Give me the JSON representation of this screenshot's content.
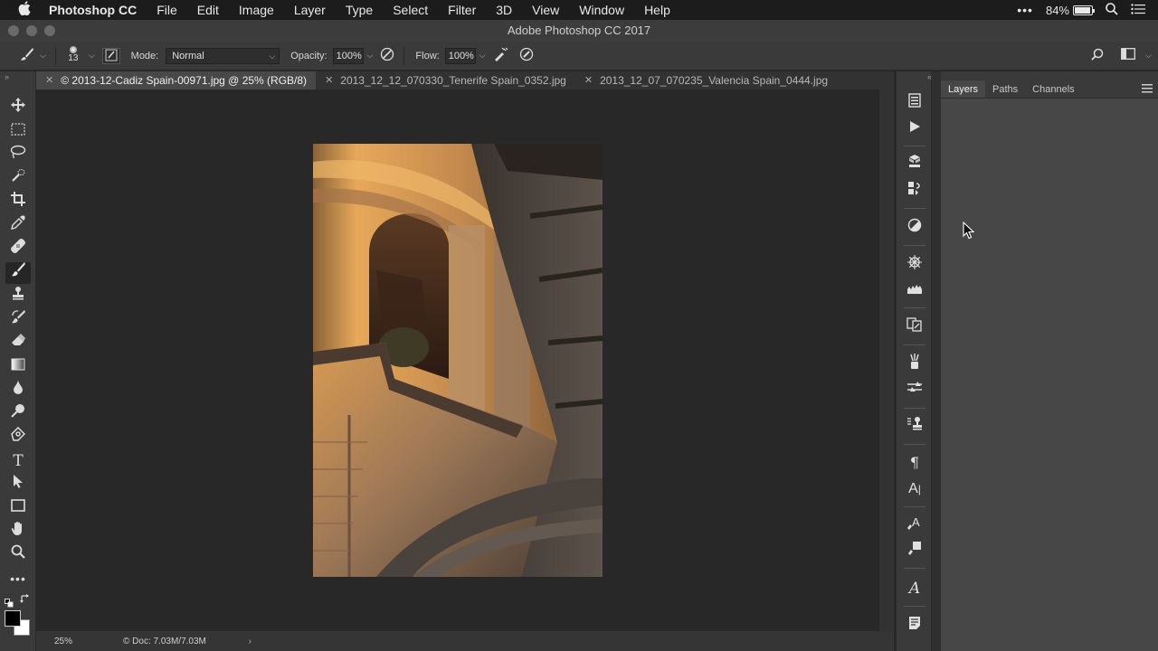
{
  "menubar": {
    "app_name": "Photoshop CC",
    "items": [
      "File",
      "Edit",
      "Image",
      "Layer",
      "Type",
      "Select",
      "Filter",
      "3D",
      "View",
      "Window",
      "Help"
    ],
    "battery_percent": "84%",
    "battery_level": 0.84,
    "icons": [
      "apple-icon",
      "more-dots-icon",
      "battery-icon",
      "spotlight-search-icon",
      "notification-list-icon"
    ]
  },
  "window": {
    "title": "Adobe Photoshop CC 2017"
  },
  "options_bar": {
    "brush_size": "13",
    "mode_label": "Mode:",
    "mode_value": "Normal",
    "opacity_label": "Opacity:",
    "opacity_value": "100%",
    "flow_label": "Flow:",
    "flow_value": "100%"
  },
  "tabs": [
    {
      "label": "© 2013-12-Cadiz Spain-00971.jpg @ 25% (RGB/8)",
      "active": true
    },
    {
      "label": "2013_12_12_070330_Tenerife Spain_0352.jpg",
      "active": false
    },
    {
      "label": "2013_12_07_070235_Valencia Spain_0444.jpg",
      "active": false
    }
  ],
  "status_bar": {
    "zoom": "25%",
    "doc_info": "Doc: 7.03M/7.03M",
    "arrow": "›"
  },
  "panel": {
    "tabs": [
      "Layers",
      "Paths",
      "Channels"
    ],
    "active_tab": "Layers"
  },
  "colors": {
    "foreground": "#000000",
    "background": "#ffffff"
  }
}
